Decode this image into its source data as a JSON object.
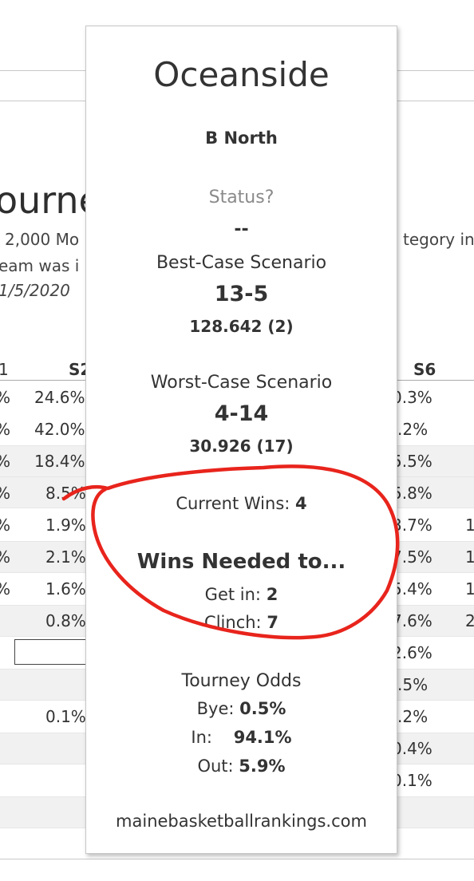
{
  "background": {
    "title_fragment": "ourne",
    "desc_line1_left": "2,000 Mo",
    "desc_line1_right": "tegory in",
    "desc_line2_left": "eam was i",
    "desc_line3_left": "1/5/2020 ",
    "col_left_header": "1",
    "col_s2_header": "S2",
    "col_s6_header": "S6",
    "left_marks": [
      "%",
      "%",
      "%",
      "%",
      "%",
      "%",
      "%"
    ],
    "s2_values": [
      "24.6%",
      "42.0%",
      "18.4%",
      "8.5%",
      "1.9%",
      "2.1%",
      "1.6%",
      "0.8%",
      "",
      "",
      "0.1%"
    ],
    "s6_values": [
      "0.3%",
      ".2%",
      "5.5%",
      "5.8%",
      "3.7%",
      "7.5%",
      "5.4%",
      "7.6%",
      "2.6%",
      ".5%",
      ".2%",
      "0.4%",
      "0.1%"
    ],
    "right_edge": [
      "1",
      "1",
      "1",
      "2"
    ]
  },
  "card": {
    "team": "Oceanside",
    "conference": "B North",
    "status_label": "Status?",
    "status_value": "--",
    "best_label": "Best-Case Scenario",
    "best_record": "13-5",
    "best_score": "128.642 (2)",
    "worst_label": "Worst-Case Scenario",
    "worst_record": "4-14",
    "worst_score": "30.926 (17)",
    "current_wins_label": "Current Wins:",
    "current_wins_value": "4",
    "wins_needed_title": "Wins Needed to...",
    "get_in_label": "Get in:",
    "get_in_value": "2",
    "clinch_label": "Clinch:",
    "clinch_value": "7",
    "odds_title": "Tourney Odds",
    "bye_label": "Bye:",
    "bye_value": "0.5%",
    "in_label": "In:",
    "in_value": "94.1%",
    "out_label": "Out:",
    "out_value": "5.9%",
    "website": "mainebasketballrankings.com"
  },
  "colors": {
    "annotation": "#e8241c",
    "band": "#f1f1f1",
    "card_border": "#c7c7c7"
  }
}
